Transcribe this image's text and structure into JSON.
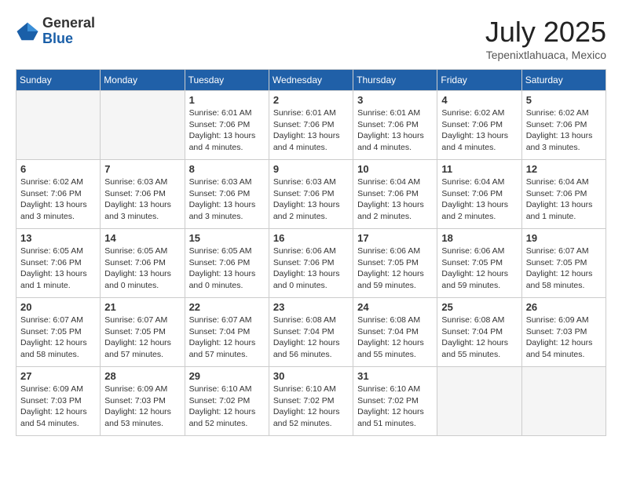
{
  "header": {
    "logo": {
      "general": "General",
      "blue": "Blue"
    },
    "title": "July 2025",
    "location": "Tepenixtlahuaca, Mexico"
  },
  "calendar": {
    "weekdays": [
      "Sunday",
      "Monday",
      "Tuesday",
      "Wednesday",
      "Thursday",
      "Friday",
      "Saturday"
    ],
    "weeks": [
      [
        {
          "day": "",
          "empty": true
        },
        {
          "day": "",
          "empty": true
        },
        {
          "day": "1",
          "detail": "Sunrise: 6:01 AM\nSunset: 7:06 PM\nDaylight: 13 hours\nand 4 minutes."
        },
        {
          "day": "2",
          "detail": "Sunrise: 6:01 AM\nSunset: 7:06 PM\nDaylight: 13 hours\nand 4 minutes."
        },
        {
          "day": "3",
          "detail": "Sunrise: 6:01 AM\nSunset: 7:06 PM\nDaylight: 13 hours\nand 4 minutes."
        },
        {
          "day": "4",
          "detail": "Sunrise: 6:02 AM\nSunset: 7:06 PM\nDaylight: 13 hours\nand 4 minutes."
        },
        {
          "day": "5",
          "detail": "Sunrise: 6:02 AM\nSunset: 7:06 PM\nDaylight: 13 hours\nand 3 minutes."
        }
      ],
      [
        {
          "day": "6",
          "detail": "Sunrise: 6:02 AM\nSunset: 7:06 PM\nDaylight: 13 hours\nand 3 minutes."
        },
        {
          "day": "7",
          "detail": "Sunrise: 6:03 AM\nSunset: 7:06 PM\nDaylight: 13 hours\nand 3 minutes."
        },
        {
          "day": "8",
          "detail": "Sunrise: 6:03 AM\nSunset: 7:06 PM\nDaylight: 13 hours\nand 3 minutes."
        },
        {
          "day": "9",
          "detail": "Sunrise: 6:03 AM\nSunset: 7:06 PM\nDaylight: 13 hours\nand 2 minutes."
        },
        {
          "day": "10",
          "detail": "Sunrise: 6:04 AM\nSunset: 7:06 PM\nDaylight: 13 hours\nand 2 minutes."
        },
        {
          "day": "11",
          "detail": "Sunrise: 6:04 AM\nSunset: 7:06 PM\nDaylight: 13 hours\nand 2 minutes."
        },
        {
          "day": "12",
          "detail": "Sunrise: 6:04 AM\nSunset: 7:06 PM\nDaylight: 13 hours\nand 1 minute."
        }
      ],
      [
        {
          "day": "13",
          "detail": "Sunrise: 6:05 AM\nSunset: 7:06 PM\nDaylight: 13 hours\nand 1 minute."
        },
        {
          "day": "14",
          "detail": "Sunrise: 6:05 AM\nSunset: 7:06 PM\nDaylight: 13 hours\nand 0 minutes."
        },
        {
          "day": "15",
          "detail": "Sunrise: 6:05 AM\nSunset: 7:06 PM\nDaylight: 13 hours\nand 0 minutes."
        },
        {
          "day": "16",
          "detail": "Sunrise: 6:06 AM\nSunset: 7:06 PM\nDaylight: 13 hours\nand 0 minutes."
        },
        {
          "day": "17",
          "detail": "Sunrise: 6:06 AM\nSunset: 7:05 PM\nDaylight: 12 hours\nand 59 minutes."
        },
        {
          "day": "18",
          "detail": "Sunrise: 6:06 AM\nSunset: 7:05 PM\nDaylight: 12 hours\nand 59 minutes."
        },
        {
          "day": "19",
          "detail": "Sunrise: 6:07 AM\nSunset: 7:05 PM\nDaylight: 12 hours\nand 58 minutes."
        }
      ],
      [
        {
          "day": "20",
          "detail": "Sunrise: 6:07 AM\nSunset: 7:05 PM\nDaylight: 12 hours\nand 58 minutes."
        },
        {
          "day": "21",
          "detail": "Sunrise: 6:07 AM\nSunset: 7:05 PM\nDaylight: 12 hours\nand 57 minutes."
        },
        {
          "day": "22",
          "detail": "Sunrise: 6:07 AM\nSunset: 7:04 PM\nDaylight: 12 hours\nand 57 minutes."
        },
        {
          "day": "23",
          "detail": "Sunrise: 6:08 AM\nSunset: 7:04 PM\nDaylight: 12 hours\nand 56 minutes."
        },
        {
          "day": "24",
          "detail": "Sunrise: 6:08 AM\nSunset: 7:04 PM\nDaylight: 12 hours\nand 55 minutes."
        },
        {
          "day": "25",
          "detail": "Sunrise: 6:08 AM\nSunset: 7:04 PM\nDaylight: 12 hours\nand 55 minutes."
        },
        {
          "day": "26",
          "detail": "Sunrise: 6:09 AM\nSunset: 7:03 PM\nDaylight: 12 hours\nand 54 minutes."
        }
      ],
      [
        {
          "day": "27",
          "detail": "Sunrise: 6:09 AM\nSunset: 7:03 PM\nDaylight: 12 hours\nand 54 minutes."
        },
        {
          "day": "28",
          "detail": "Sunrise: 6:09 AM\nSunset: 7:03 PM\nDaylight: 12 hours\nand 53 minutes."
        },
        {
          "day": "29",
          "detail": "Sunrise: 6:10 AM\nSunset: 7:02 PM\nDaylight: 12 hours\nand 52 minutes."
        },
        {
          "day": "30",
          "detail": "Sunrise: 6:10 AM\nSunset: 7:02 PM\nDaylight: 12 hours\nand 52 minutes."
        },
        {
          "day": "31",
          "detail": "Sunrise: 6:10 AM\nSunset: 7:02 PM\nDaylight: 12 hours\nand 51 minutes."
        },
        {
          "day": "",
          "empty": true
        },
        {
          "day": "",
          "empty": true
        }
      ]
    ]
  }
}
